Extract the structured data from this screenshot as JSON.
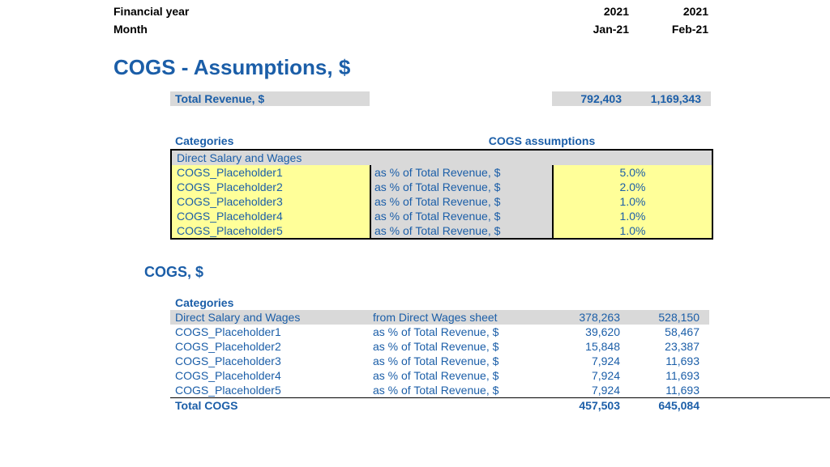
{
  "header": {
    "fy_label": "Financial year",
    "month_label": "Month",
    "years": [
      "2021",
      "2021"
    ],
    "months": [
      "Jan-21",
      "Feb-21"
    ]
  },
  "title": "COGS - Assumptions, $",
  "revenue": {
    "label": "Total Revenue, $",
    "values": [
      "792,403",
      "1,169,343"
    ]
  },
  "assumptions": {
    "cat_header": "Categories",
    "cogs_header": "COGS assumptions",
    "rows": [
      {
        "name": "Direct Salary and Wages",
        "basis": "",
        "pct": ""
      },
      {
        "name": "COGS_Placeholder1",
        "basis": "as % of Total Revenue, $",
        "pct": "5.0%"
      },
      {
        "name": "COGS_Placeholder2",
        "basis": "as % of Total Revenue, $",
        "pct": "2.0%"
      },
      {
        "name": "COGS_Placeholder3",
        "basis": "as % of Total Revenue, $",
        "pct": "1.0%"
      },
      {
        "name": "COGS_Placeholder4",
        "basis": "as % of Total Revenue, $",
        "pct": "1.0%"
      },
      {
        "name": "COGS_Placeholder5",
        "basis": "as % of Total Revenue, $",
        "pct": "1.0%"
      }
    ]
  },
  "cogs": {
    "title": "COGS, $",
    "cat_header": "Categories",
    "rows": [
      {
        "name": "Direct Salary and Wages",
        "basis": "from Direct Wages sheet",
        "v1": "378,263",
        "v2": "528,150"
      },
      {
        "name": "COGS_Placeholder1",
        "basis": "as % of Total Revenue, $",
        "v1": "39,620",
        "v2": "58,467"
      },
      {
        "name": "COGS_Placeholder2",
        "basis": "as % of Total Revenue, $",
        "v1": "15,848",
        "v2": "23,387"
      },
      {
        "name": "COGS_Placeholder3",
        "basis": "as % of Total Revenue, $",
        "v1": "7,924",
        "v2": "11,693"
      },
      {
        "name": "COGS_Placeholder4",
        "basis": "as % of Total Revenue, $",
        "v1": "7,924",
        "v2": "11,693"
      },
      {
        "name": "COGS_Placeholder5",
        "basis": "as % of Total Revenue, $",
        "v1": "7,924",
        "v2": "11,693"
      }
    ],
    "total_label": "Total COGS",
    "total_v1": "457,503",
    "total_v2": "645,084"
  }
}
